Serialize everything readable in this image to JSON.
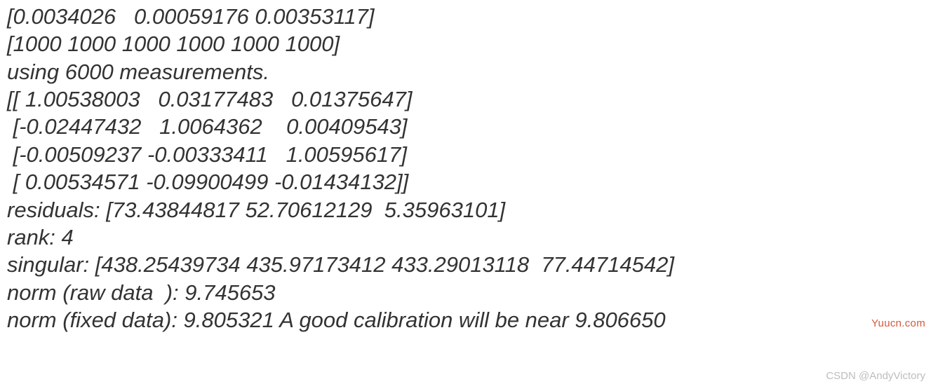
{
  "lines": {
    "l1": "[0.0034026   0.00059176 0.00353117]",
    "l2": "[1000 1000 1000 1000 1000 1000]",
    "l3": "using 6000 measurements.",
    "l4": "[[ 1.00538003   0.03177483   0.01375647]",
    "l5": " [-0.02447432   1.0064362    0.00409543]",
    "l6": " [-0.00509237 -0.00333411   1.00595617]",
    "l7": " [ 0.00534571 -0.09900499 -0.01434132]]",
    "l8": "residuals: [73.43844817 52.70612129  5.35963101]",
    "l9": "rank: 4",
    "l10": "singular: [438.25439734 435.97173412 433.29013118  77.44714542]",
    "l11": "norm (raw data  ): 9.745653",
    "l12": "norm (fixed data): 9.805321 A good calibration will be near 9.806650"
  },
  "watermarks": {
    "top": "Yuucn.com",
    "bottom": "CSDN @AndyVictory"
  }
}
